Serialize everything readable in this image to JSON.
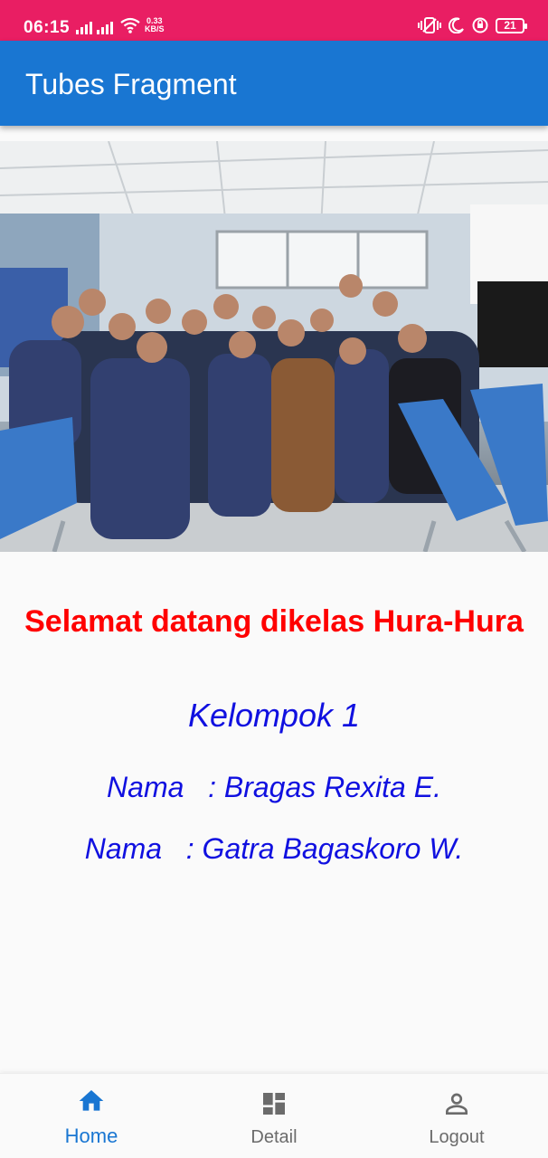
{
  "status_bar": {
    "time": "06:15",
    "network_speed_value": "0.33",
    "network_speed_unit": "KB/S",
    "battery": "21",
    "icons": [
      "signal-icon",
      "signal-icon",
      "wifi-icon",
      "vibrate-icon",
      "moon-icon",
      "alarm-icon",
      "battery-icon"
    ]
  },
  "app_bar": {
    "title": "Tubes Fragment"
  },
  "colors": {
    "status_bar": "#e91e63",
    "app_bar": "#1976d2",
    "welcome_text": "#ff0000",
    "body_text": "#1010e0",
    "nav_active": "#1976d2",
    "nav_inactive": "#6b6b6b"
  },
  "content": {
    "welcome": "Selamat datang dikelas Hura-Hura",
    "group": "Kelompok 1",
    "members": [
      "Nama   : Bragas Rexita E.",
      "Nama   : Gatra Bagaskoro W."
    ]
  },
  "bottom_nav": {
    "items": [
      {
        "label": "Home",
        "icon": "home-icon",
        "active": true
      },
      {
        "label": "Detail",
        "icon": "dashboard-icon",
        "active": false
      },
      {
        "label": "Logout",
        "icon": "person-icon",
        "active": false
      }
    ]
  }
}
